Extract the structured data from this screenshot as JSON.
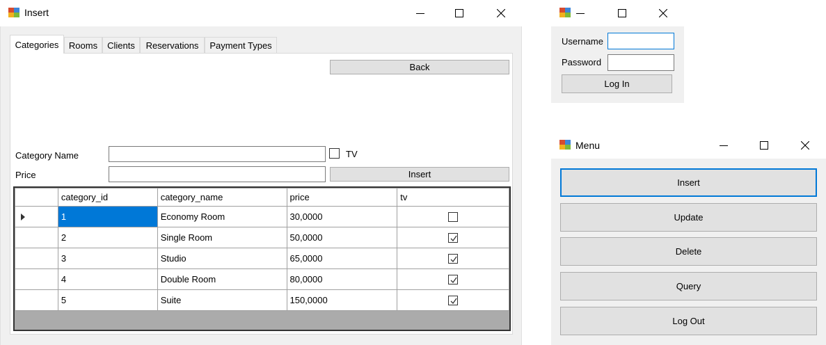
{
  "insert_window": {
    "title": "Insert",
    "tabs": [
      {
        "label": "Categories",
        "active": true
      },
      {
        "label": "Rooms",
        "active": false
      },
      {
        "label": "Clients",
        "active": false
      },
      {
        "label": "Reservations",
        "active": false
      },
      {
        "label": "Payment Types",
        "active": false
      }
    ],
    "back_label": "Back",
    "category_name_label": "Category Name",
    "category_name_value": "",
    "price_label": "Price",
    "price_value": "",
    "tv_label": "TV",
    "tv_checked": false,
    "insert_label": "Insert",
    "grid": {
      "columns": [
        "category_id",
        "category_name",
        "price",
        "tv"
      ],
      "rows": [
        {
          "category_id": "1",
          "category_name": "Economy Room",
          "price": "30,0000",
          "tv": false,
          "selected": true
        },
        {
          "category_id": "2",
          "category_name": "Single Room",
          "price": "50,0000",
          "tv": true,
          "selected": false
        },
        {
          "category_id": "3",
          "category_name": "Studio",
          "price": "65,0000",
          "tv": true,
          "selected": false
        },
        {
          "category_id": "4",
          "category_name": "Double Room",
          "price": "80,0000",
          "tv": true,
          "selected": false
        },
        {
          "category_id": "5",
          "category_name": "Suite",
          "price": "150,0000",
          "tv": true,
          "selected": false
        }
      ]
    }
  },
  "login_window": {
    "title": "",
    "username_label": "Username",
    "username_value": "",
    "password_label": "Password",
    "password_value": "",
    "login_label": "Log In"
  },
  "menu_window": {
    "title": "Menu",
    "buttons": [
      "Insert",
      "Update",
      "Delete",
      "Query",
      "Log Out"
    ]
  },
  "colors": {
    "accent": "#0078d7",
    "button_face": "#e1e1e1",
    "client_bg": "#f0f0f0"
  }
}
